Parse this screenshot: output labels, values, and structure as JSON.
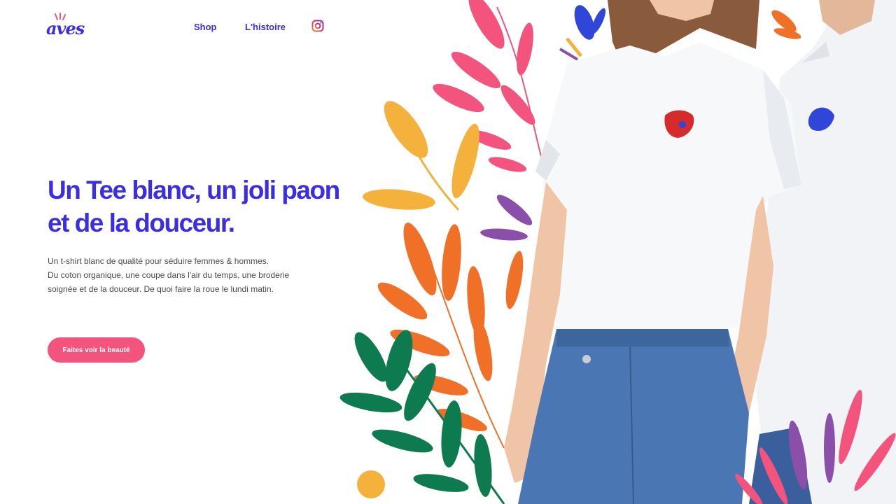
{
  "brand": {
    "name": "aves"
  },
  "nav": {
    "items": [
      {
        "label": "Shop"
      },
      {
        "label": "L'histoire"
      }
    ],
    "instagram_icon": "instagram-icon"
  },
  "hero": {
    "headline": "Un Tee blanc, un joli paon et de la douceur.",
    "description_lines": [
      "Un t-shirt blanc de qualité pour séduire femmes & hommes.",
      "Du coton organique, une coupe dans l'air du temps, une broderie",
      "soignée et de la douceur. De quoi faire la roue le lundi matin."
    ],
    "cta_label": "Faites voir la beauté"
  },
  "colors": {
    "primary": "#3b2ee0",
    "accent": "#f2547d",
    "leaf_yellow": "#f4b13b",
    "leaf_orange": "#f07027",
    "leaf_green": "#0e7a4f",
    "leaf_purple": "#8a4fa8",
    "leaf_blue": "#2f46d8",
    "denim": "#4a77b4"
  }
}
